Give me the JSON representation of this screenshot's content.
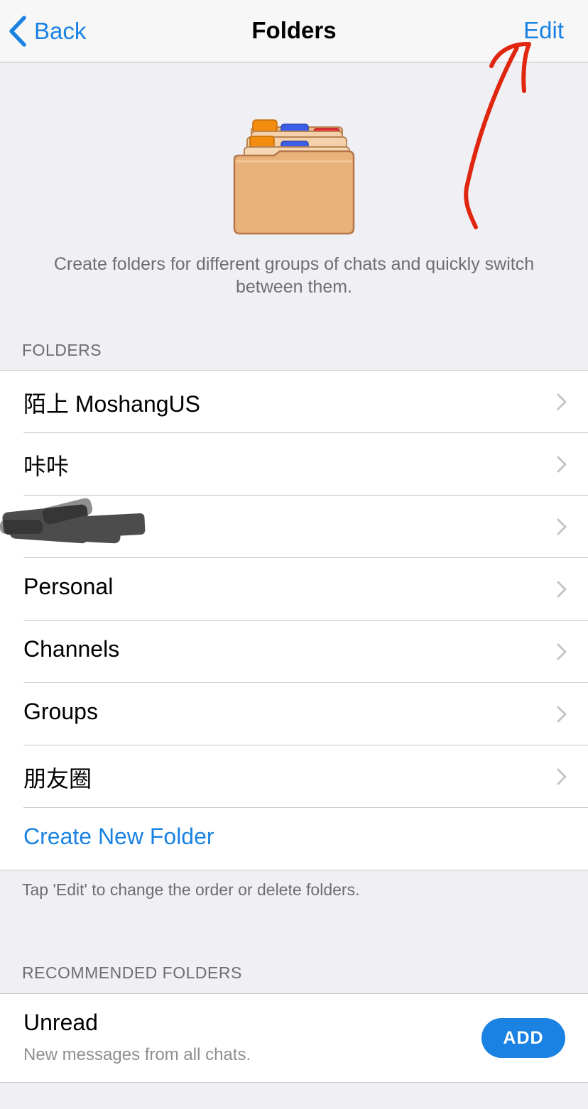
{
  "nav": {
    "back_label": "Back",
    "title": "Folders",
    "edit_label": "Edit"
  },
  "intro": {
    "text": "Create folders for different groups of chats and quickly switch between them."
  },
  "folders_section": {
    "header": "FOLDERS",
    "items": [
      {
        "label": "陌上 MoshangUS"
      },
      {
        "label": "咔咔"
      },
      {
        "label": "",
        "redacted": true
      },
      {
        "label": "Personal"
      },
      {
        "label": "Channels"
      },
      {
        "label": "Groups"
      },
      {
        "label": "朋友圈"
      }
    ],
    "create_label": "Create New Folder",
    "footer": "Tap 'Edit' to change the order or delete folders."
  },
  "recommended_section": {
    "header": "RECOMMENDED FOLDERS",
    "items": [
      {
        "title": "Unread",
        "subtitle": "New messages from all chats.",
        "button_label": "ADD"
      }
    ]
  },
  "colors": {
    "accent": "#1a82e2",
    "background": "#efeff4",
    "annotation": "#e0260f"
  },
  "icons": {
    "back": "chevron-left-icon",
    "row": "chevron-right-icon",
    "illustration": "folder-files-icon",
    "annotation": "red-arrow-annotation"
  }
}
